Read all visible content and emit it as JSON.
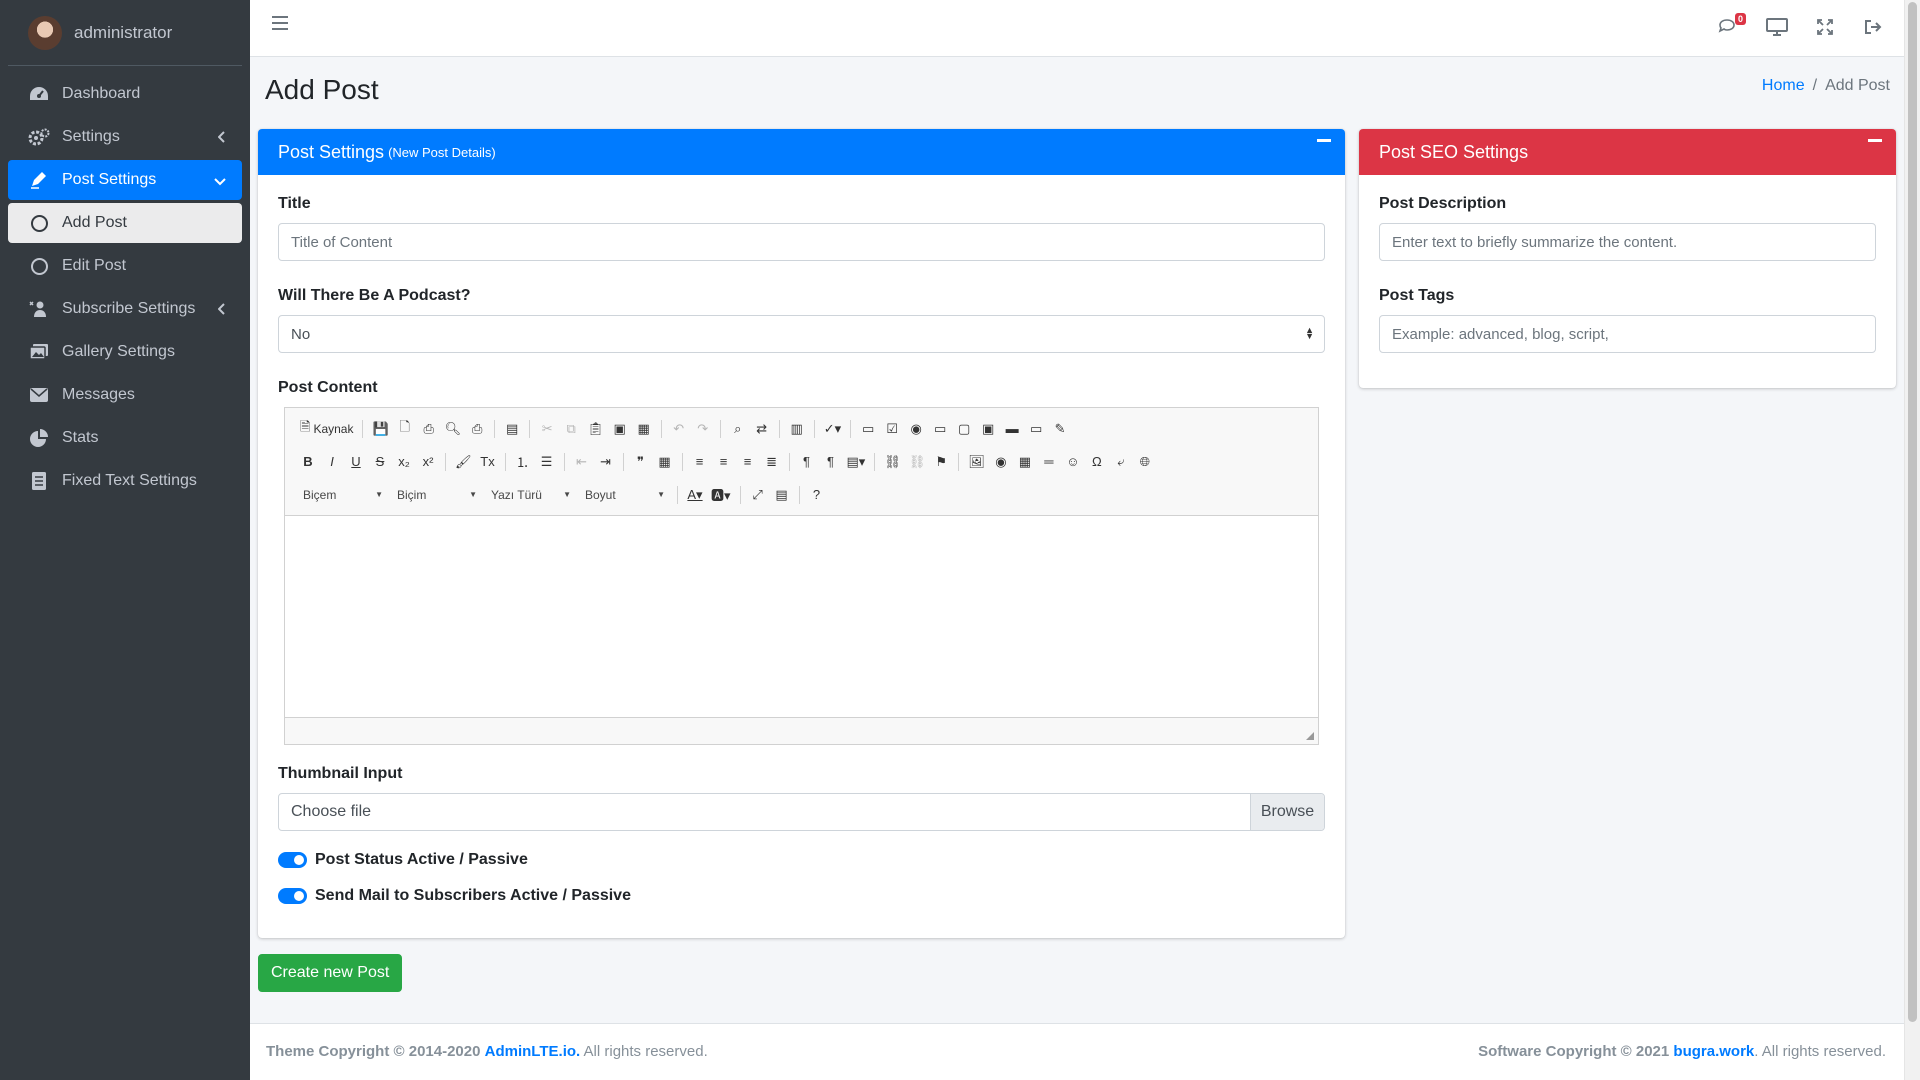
{
  "user": {
    "name": "administrator"
  },
  "sidebar": {
    "items": [
      {
        "label": "Dashboard",
        "icon": "dashboard-icon"
      },
      {
        "label": "Settings",
        "icon": "gears-icon"
      },
      {
        "label": "Post Settings",
        "icon": "edit-icon",
        "active": true
      },
      {
        "label": "Add Post",
        "icon": "circle-icon",
        "sub": true,
        "selected": true
      },
      {
        "label": "Edit Post",
        "icon": "circle-icon",
        "sub": true
      },
      {
        "label": "Subscribe Settings",
        "icon": "user-plus-icon"
      },
      {
        "label": "Gallery Settings",
        "icon": "images-icon"
      },
      {
        "label": "Messages",
        "icon": "envelope-icon"
      },
      {
        "label": "Stats",
        "icon": "pie-chart-icon"
      },
      {
        "label": "Fixed Text Settings",
        "icon": "file-text-icon"
      }
    ]
  },
  "topbar": {
    "message_count": "0"
  },
  "page": {
    "title": "Add Post"
  },
  "breadcrumb": {
    "home": "Home",
    "current": "Add Post"
  },
  "post_card": {
    "header": "Post Settings",
    "header_small": "(New Post Details)",
    "color": "#007bff",
    "title_label": "Title",
    "title_placeholder": "Title of Content",
    "podcast_label": "Will There Be A Podcast?",
    "podcast_value": "No",
    "content_label": "Post Content",
    "thumbnail_label": "Thumbnail Input",
    "file_placeholder": "Choose file",
    "browse_label": "Browse",
    "status_label": "Post Status Active / Passive",
    "mail_label": "Send Mail to Subscribers Active / Passive"
  },
  "editor": {
    "source_label": "Kaynak",
    "styles_label": "Biçem",
    "format_label": "Biçim",
    "font_label": "Yazı Türü",
    "size_label": "Boyut"
  },
  "seo_card": {
    "header": "Post SEO Settings",
    "color": "#dc3545",
    "desc_label": "Post Description",
    "desc_placeholder": "Enter text to briefly summarize the content.",
    "tags_label": "Post Tags",
    "tags_placeholder": "Example: advanced, blog, script,"
  },
  "actions": {
    "create_label": "Create new Post"
  },
  "footer": {
    "left_prefix": "Theme Copyright © 2014-2020",
    "left_link": "AdminLTE.io.",
    "left_suffix": "All rights reserved.",
    "right_prefix": "Software Copyright © 2021",
    "right_link": "bugra.work",
    "right_suffix": ". All rights reserved."
  }
}
